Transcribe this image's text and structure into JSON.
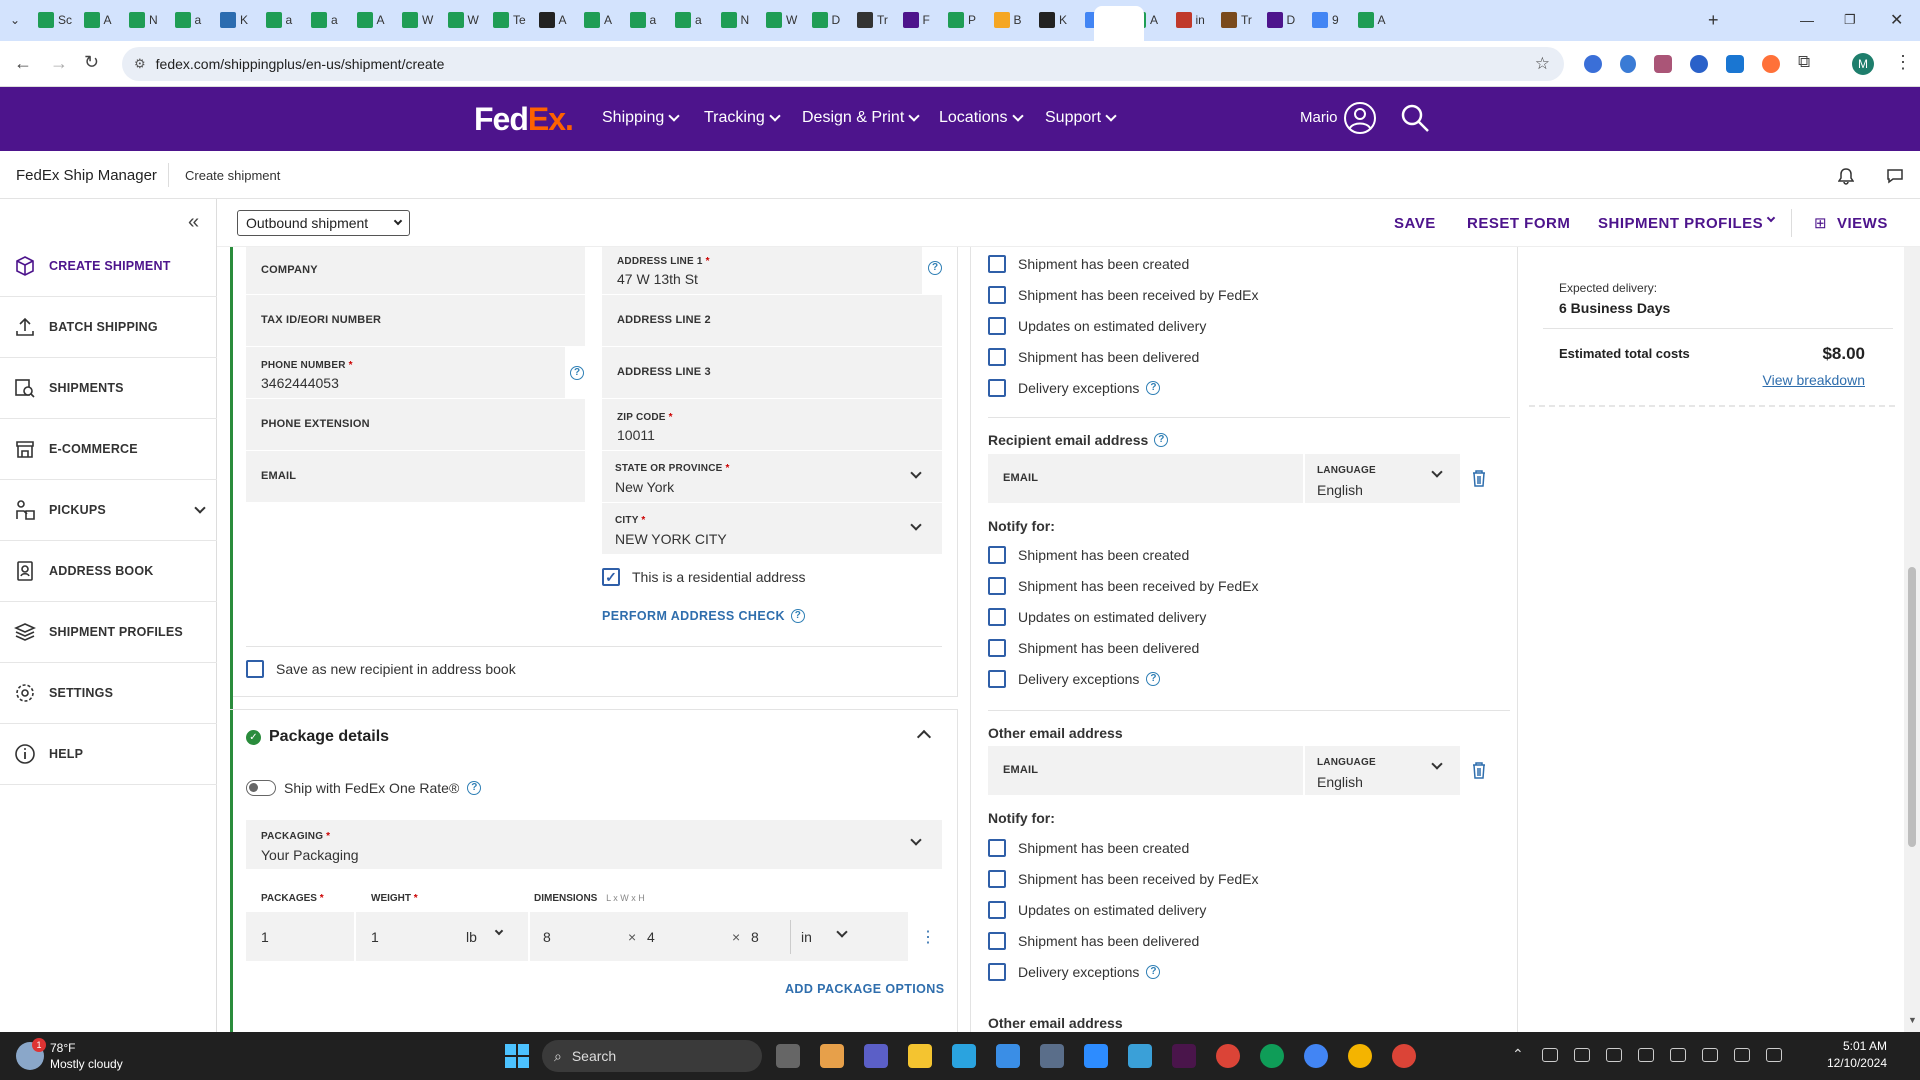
{
  "browser": {
    "tabs": [
      "Sc",
      "A",
      "N",
      "a",
      "K",
      "a",
      "a",
      "A",
      "W",
      "W",
      "Te",
      "A",
      "A",
      "a",
      "a",
      "N",
      "W",
      "D",
      "Tr",
      "F",
      "P",
      "B",
      "K",
      "M",
      "A",
      "in",
      "Tr",
      "D",
      "9",
      "A"
    ],
    "url": "fedex.com/shippingplus/en-us/shipment/create",
    "profile_initial": "M"
  },
  "fedex_header": {
    "logo_fed": "Fed",
    "logo_ex": "Ex",
    "logo_dot": ".",
    "nav": [
      "Shipping",
      "Tracking",
      "Design & Print",
      "Locations",
      "Support"
    ],
    "user": "Mario"
  },
  "subheader": {
    "app": "FedEx Ship Manager",
    "page": "Create shipment"
  },
  "sidebar": {
    "items": [
      {
        "label": "CREATE SHIPMENT",
        "active": true
      },
      {
        "label": "BATCH SHIPPING"
      },
      {
        "label": "SHIPMENTS"
      },
      {
        "label": "E-COMMERCE"
      },
      {
        "label": "PICKUPS"
      },
      {
        "label": "ADDRESS BOOK"
      },
      {
        "label": "SHIPMENT PROFILES"
      },
      {
        "label": "SETTINGS"
      },
      {
        "label": "HELP"
      }
    ]
  },
  "actionbar": {
    "shipment_type": "Outbound shipment",
    "save": "SAVE",
    "reset": "RESET FORM",
    "profiles": "SHIPMENT PROFILES",
    "views": "VIEWS"
  },
  "recipient": {
    "company_label": "COMPANY",
    "tax_label": "TAX ID/EORI NUMBER",
    "phone_label": "PHONE NUMBER",
    "phone_value": "3462444053",
    "phone_ext_label": "PHONE EXTENSION",
    "email_label": "EMAIL",
    "addr1_label": "ADDRESS LINE 1",
    "addr1_value": "47 W 13th St",
    "addr2_label": "ADDRESS LINE 2",
    "addr3_label": "ADDRESS LINE 3",
    "zip_label": "ZIP CODE",
    "zip_value": "10011",
    "state_label": "STATE OR PROVINCE",
    "state_value": "New York",
    "city_label": "CITY",
    "city_value": "NEW YORK CITY",
    "residential_label": "This is a residential address",
    "address_check": "PERFORM ADDRESS CHECK",
    "save_recipient": "Save as new recipient in address book",
    "req": "*"
  },
  "package": {
    "title": "Package details",
    "one_rate": "Ship with FedEx One Rate®",
    "packaging_label": "PACKAGING",
    "packaging_value": "Your Packaging",
    "packages_label": "PACKAGES",
    "weight_label": "WEIGHT",
    "dimensions_label": "DIMENSIONS",
    "dimensions_hint": "L x W x H",
    "packages_value": "1",
    "weight_value": "1",
    "weight_unit": "lb",
    "dim_l": "8",
    "dim_w": "4",
    "dim_h": "8",
    "dim_unit": "in",
    "times": "×",
    "add_options": "ADD PACKAGE OPTIONS"
  },
  "notifications": {
    "events": [
      "Shipment has been created",
      "Shipment has been received by FedEx",
      "Updates on estimated delivery",
      "Shipment has been delivered",
      "Delivery exceptions"
    ],
    "recipient_email_title": "Recipient email address",
    "email_label": "EMAIL",
    "language_label": "LANGUAGE",
    "language_value": "English",
    "notify_for": "Notify for:",
    "other_email_title": "Other email address"
  },
  "summary": {
    "expected_label": "Expected delivery:",
    "expected_value": "6 Business Days",
    "total_label": "Estimated total costs",
    "total_value": "$8.00",
    "breakdown": "View breakdown"
  },
  "taskbar": {
    "weather_temp": "78°F",
    "weather_desc": "Mostly cloudy",
    "weather_badge": "1",
    "search": "Search",
    "time": "5:01 AM",
    "date": "12/10/2024"
  },
  "colors": {
    "fedex_purple": "#4d148c",
    "fedex_orange": "#ff6200",
    "link_blue": "#2f6ead",
    "green": "#2a8c3c"
  }
}
